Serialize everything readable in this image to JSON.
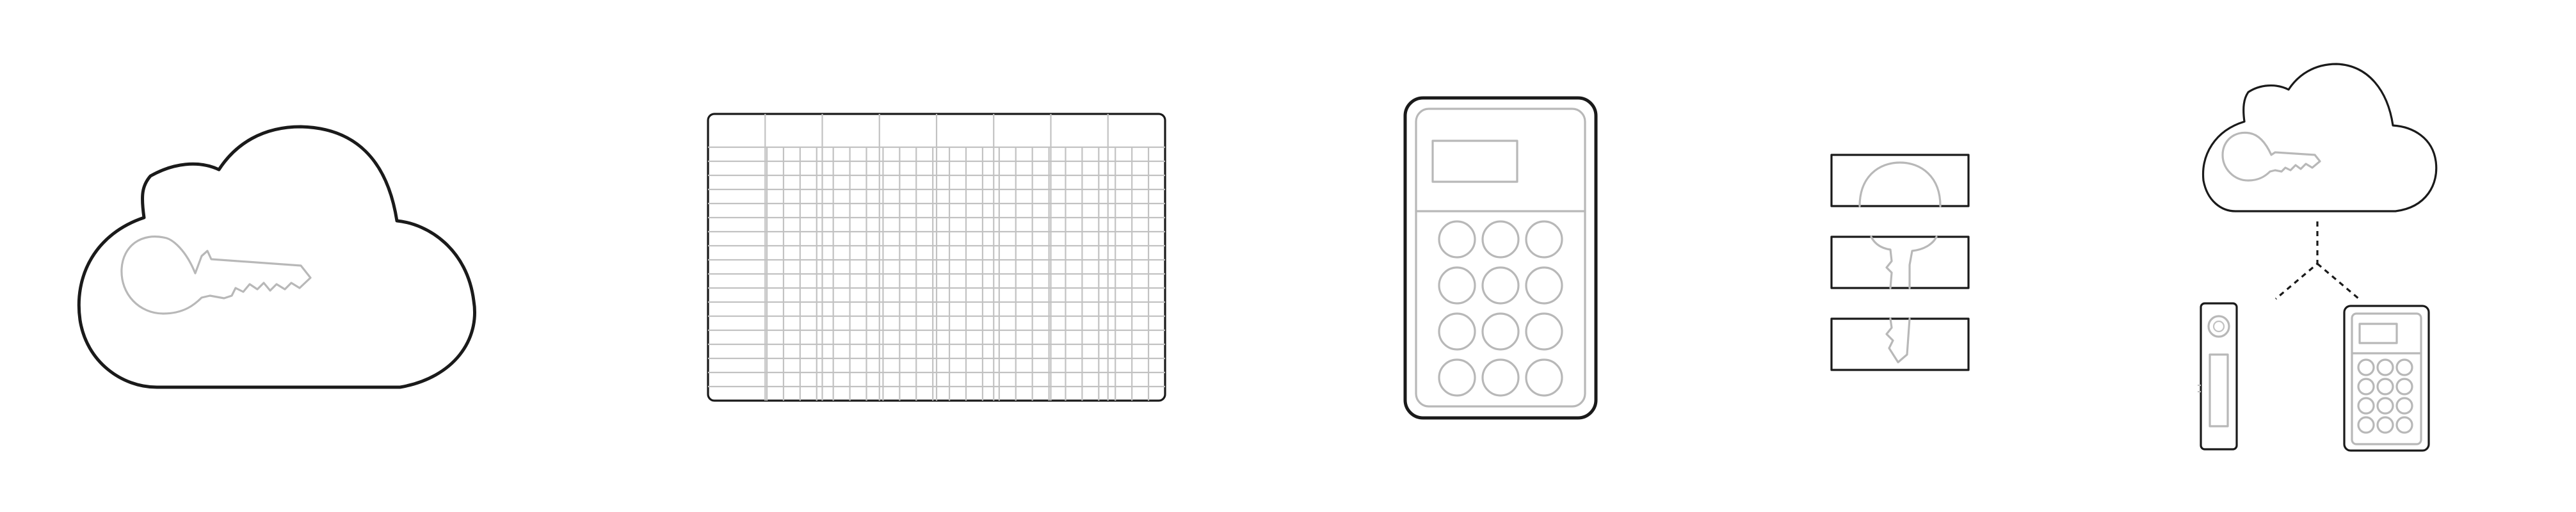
{
  "illustrations": [
    {
      "icon": "cloud-key-icon"
    },
    {
      "icon": "recovery-grid-card-icon"
    },
    {
      "icon": "keypad-device-icon"
    },
    {
      "icon": "split-key-shards-icon"
    },
    {
      "icon": "cloud-backup-to-devices-icon"
    }
  ],
  "colors": {
    "outline": "#1a1a1a",
    "detail": "#b8b8b8",
    "background": "#ffffff"
  }
}
